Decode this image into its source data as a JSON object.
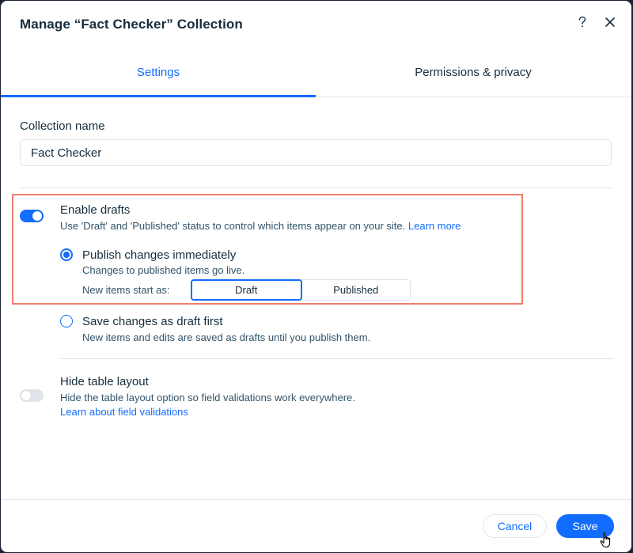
{
  "dialog": {
    "title": "Manage “Fact Checker” Collection",
    "help_icon": "question-mark-icon",
    "close_icon": "close-icon"
  },
  "tabs": [
    {
      "label": "Settings",
      "active": true
    },
    {
      "label": "Permissions & privacy",
      "active": false
    }
  ],
  "collection_name": {
    "label": "Collection name",
    "value": "Fact Checker"
  },
  "drafts": {
    "title": "Enable drafts",
    "enabled": true,
    "description": "Use 'Draft' and 'Published' status to control which items appear on your site.",
    "learn_more": "Learn more",
    "options": [
      {
        "label": "Publish changes immediately",
        "description": "Changes to published items go live.",
        "selected": true
      },
      {
        "label": "Save changes as draft first",
        "description": "New items and edits are saved as drafts until you publish them.",
        "selected": false
      }
    ],
    "new_items": {
      "label": "New items start as:",
      "options": [
        "Draft",
        "Published"
      ],
      "selected": "Draft"
    }
  },
  "table_layout": {
    "title": "Hide table layout",
    "enabled": false,
    "description": "Hide the table layout option so field validations work everywhere.",
    "link": "Learn about field validations"
  },
  "footer": {
    "cancel_label": "Cancel",
    "save_label": "Save"
  },
  "colors": {
    "accent": "#116dff",
    "highlight_border": "#f07e6e",
    "text_primary": "#162d3d",
    "text_secondary": "#32536a",
    "divider": "#dfe5eb"
  }
}
